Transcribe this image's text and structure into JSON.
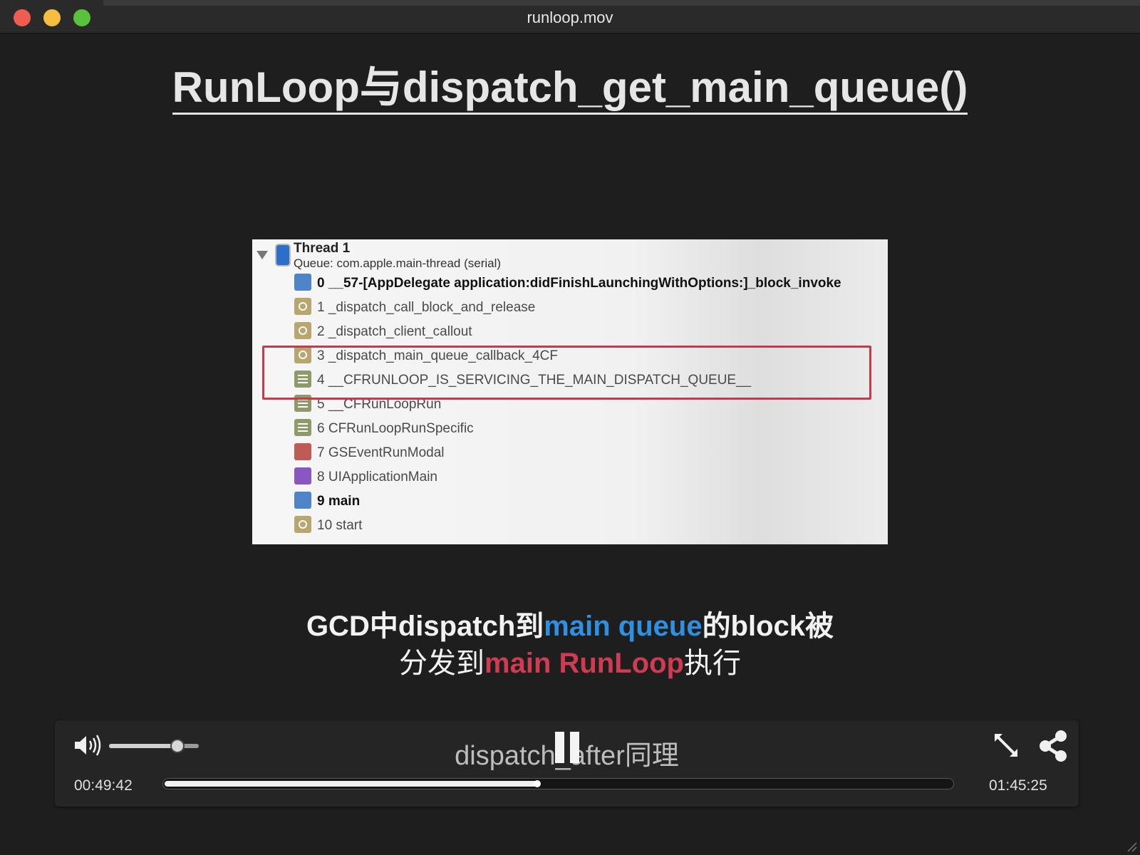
{
  "window": {
    "title": "runloop.mov"
  },
  "slide": {
    "title": "RunLoop与dispatch_get_main_queue()",
    "thread": {
      "title": "Thread 1",
      "queue": "Queue: com.apple.main-thread (serial)"
    },
    "frames": [
      {
        "label": "0 __57-[AppDelegate application:didFinishLaunchingWithOptions:]_block_invoke",
        "icon": "user-code-icon",
        "bold": true
      },
      {
        "label": "1 _dispatch_call_block_and_release",
        "icon": "library-gear-icon",
        "bold": false
      },
      {
        "label": "2 _dispatch_client_callout",
        "icon": "library-gear-icon",
        "bold": false
      },
      {
        "label": "3 _dispatch_main_queue_callback_4CF",
        "icon": "library-gear-icon",
        "bold": false
      },
      {
        "label": "4 __CFRUNLOOP_IS_SERVICING_THE_MAIN_DISPATCH_QUEUE__",
        "icon": "corefoundation-icon",
        "bold": false
      },
      {
        "label": "5 __CFRunLoopRun",
        "icon": "corefoundation-icon",
        "bold": false
      },
      {
        "label": "6 CFRunLoopRunSpecific",
        "icon": "corefoundation-icon",
        "bold": false
      },
      {
        "label": "7 GSEventRunModal",
        "icon": "graphics-services-icon",
        "bold": false
      },
      {
        "label": "8 UIApplicationMain",
        "icon": "uikit-icon",
        "bold": false
      },
      {
        "label": "9 main",
        "icon": "user-code-icon",
        "bold": true
      },
      {
        "label": "10 start",
        "icon": "library-gear-icon",
        "bold": false
      }
    ],
    "caption_line1": {
      "a": "GCD中dispatch到",
      "b": "main queue",
      "c": "的block被"
    },
    "caption_line2": {
      "a": "分发到",
      "b": "main RunLoop",
      "c": "执行"
    },
    "colors": {
      "blue": "#2f8fe0",
      "red": "#cf3c52",
      "highlight_box": "#c43b4e"
    }
  },
  "player": {
    "subtitle": "dispatch_after同理",
    "current_time": "00:49:42",
    "total_time": "01:45:25",
    "progress_fraction": 0.4726,
    "volume_fraction": 0.75
  }
}
